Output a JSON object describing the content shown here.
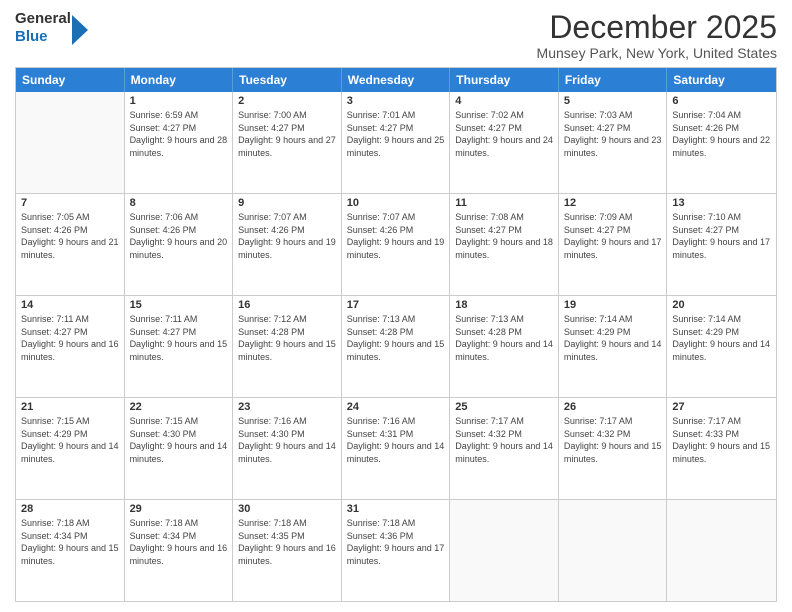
{
  "header": {
    "logo_general": "General",
    "logo_blue": "Blue",
    "title": "December 2025",
    "subtitle": "Munsey Park, New York, United States"
  },
  "days_of_week": [
    "Sunday",
    "Monday",
    "Tuesday",
    "Wednesday",
    "Thursday",
    "Friday",
    "Saturday"
  ],
  "weeks": [
    [
      {
        "day": "",
        "sunrise": "",
        "sunset": "",
        "daylight": ""
      },
      {
        "day": "1",
        "sunrise": "Sunrise: 6:59 AM",
        "sunset": "Sunset: 4:27 PM",
        "daylight": "Daylight: 9 hours and 28 minutes."
      },
      {
        "day": "2",
        "sunrise": "Sunrise: 7:00 AM",
        "sunset": "Sunset: 4:27 PM",
        "daylight": "Daylight: 9 hours and 27 minutes."
      },
      {
        "day": "3",
        "sunrise": "Sunrise: 7:01 AM",
        "sunset": "Sunset: 4:27 PM",
        "daylight": "Daylight: 9 hours and 25 minutes."
      },
      {
        "day": "4",
        "sunrise": "Sunrise: 7:02 AM",
        "sunset": "Sunset: 4:27 PM",
        "daylight": "Daylight: 9 hours and 24 minutes."
      },
      {
        "day": "5",
        "sunrise": "Sunrise: 7:03 AM",
        "sunset": "Sunset: 4:27 PM",
        "daylight": "Daylight: 9 hours and 23 minutes."
      },
      {
        "day": "6",
        "sunrise": "Sunrise: 7:04 AM",
        "sunset": "Sunset: 4:26 PM",
        "daylight": "Daylight: 9 hours and 22 minutes."
      }
    ],
    [
      {
        "day": "7",
        "sunrise": "Sunrise: 7:05 AM",
        "sunset": "Sunset: 4:26 PM",
        "daylight": "Daylight: 9 hours and 21 minutes."
      },
      {
        "day": "8",
        "sunrise": "Sunrise: 7:06 AM",
        "sunset": "Sunset: 4:26 PM",
        "daylight": "Daylight: 9 hours and 20 minutes."
      },
      {
        "day": "9",
        "sunrise": "Sunrise: 7:07 AM",
        "sunset": "Sunset: 4:26 PM",
        "daylight": "Daylight: 9 hours and 19 minutes."
      },
      {
        "day": "10",
        "sunrise": "Sunrise: 7:07 AM",
        "sunset": "Sunset: 4:26 PM",
        "daylight": "Daylight: 9 hours and 19 minutes."
      },
      {
        "day": "11",
        "sunrise": "Sunrise: 7:08 AM",
        "sunset": "Sunset: 4:27 PM",
        "daylight": "Daylight: 9 hours and 18 minutes."
      },
      {
        "day": "12",
        "sunrise": "Sunrise: 7:09 AM",
        "sunset": "Sunset: 4:27 PM",
        "daylight": "Daylight: 9 hours and 17 minutes."
      },
      {
        "day": "13",
        "sunrise": "Sunrise: 7:10 AM",
        "sunset": "Sunset: 4:27 PM",
        "daylight": "Daylight: 9 hours and 17 minutes."
      }
    ],
    [
      {
        "day": "14",
        "sunrise": "Sunrise: 7:11 AM",
        "sunset": "Sunset: 4:27 PM",
        "daylight": "Daylight: 9 hours and 16 minutes."
      },
      {
        "day": "15",
        "sunrise": "Sunrise: 7:11 AM",
        "sunset": "Sunset: 4:27 PM",
        "daylight": "Daylight: 9 hours and 15 minutes."
      },
      {
        "day": "16",
        "sunrise": "Sunrise: 7:12 AM",
        "sunset": "Sunset: 4:28 PM",
        "daylight": "Daylight: 9 hours and 15 minutes."
      },
      {
        "day": "17",
        "sunrise": "Sunrise: 7:13 AM",
        "sunset": "Sunset: 4:28 PM",
        "daylight": "Daylight: 9 hours and 15 minutes."
      },
      {
        "day": "18",
        "sunrise": "Sunrise: 7:13 AM",
        "sunset": "Sunset: 4:28 PM",
        "daylight": "Daylight: 9 hours and 14 minutes."
      },
      {
        "day": "19",
        "sunrise": "Sunrise: 7:14 AM",
        "sunset": "Sunset: 4:29 PM",
        "daylight": "Daylight: 9 hours and 14 minutes."
      },
      {
        "day": "20",
        "sunrise": "Sunrise: 7:14 AM",
        "sunset": "Sunset: 4:29 PM",
        "daylight": "Daylight: 9 hours and 14 minutes."
      }
    ],
    [
      {
        "day": "21",
        "sunrise": "Sunrise: 7:15 AM",
        "sunset": "Sunset: 4:29 PM",
        "daylight": "Daylight: 9 hours and 14 minutes."
      },
      {
        "day": "22",
        "sunrise": "Sunrise: 7:15 AM",
        "sunset": "Sunset: 4:30 PM",
        "daylight": "Daylight: 9 hours and 14 minutes."
      },
      {
        "day": "23",
        "sunrise": "Sunrise: 7:16 AM",
        "sunset": "Sunset: 4:30 PM",
        "daylight": "Daylight: 9 hours and 14 minutes."
      },
      {
        "day": "24",
        "sunrise": "Sunrise: 7:16 AM",
        "sunset": "Sunset: 4:31 PM",
        "daylight": "Daylight: 9 hours and 14 minutes."
      },
      {
        "day": "25",
        "sunrise": "Sunrise: 7:17 AM",
        "sunset": "Sunset: 4:32 PM",
        "daylight": "Daylight: 9 hours and 14 minutes."
      },
      {
        "day": "26",
        "sunrise": "Sunrise: 7:17 AM",
        "sunset": "Sunset: 4:32 PM",
        "daylight": "Daylight: 9 hours and 15 minutes."
      },
      {
        "day": "27",
        "sunrise": "Sunrise: 7:17 AM",
        "sunset": "Sunset: 4:33 PM",
        "daylight": "Daylight: 9 hours and 15 minutes."
      }
    ],
    [
      {
        "day": "28",
        "sunrise": "Sunrise: 7:18 AM",
        "sunset": "Sunset: 4:34 PM",
        "daylight": "Daylight: 9 hours and 15 minutes."
      },
      {
        "day": "29",
        "sunrise": "Sunrise: 7:18 AM",
        "sunset": "Sunset: 4:34 PM",
        "daylight": "Daylight: 9 hours and 16 minutes."
      },
      {
        "day": "30",
        "sunrise": "Sunrise: 7:18 AM",
        "sunset": "Sunset: 4:35 PM",
        "daylight": "Daylight: 9 hours and 16 minutes."
      },
      {
        "day": "31",
        "sunrise": "Sunrise: 7:18 AM",
        "sunset": "Sunset: 4:36 PM",
        "daylight": "Daylight: 9 hours and 17 minutes."
      },
      {
        "day": "",
        "sunrise": "",
        "sunset": "",
        "daylight": ""
      },
      {
        "day": "",
        "sunrise": "",
        "sunset": "",
        "daylight": ""
      },
      {
        "day": "",
        "sunrise": "",
        "sunset": "",
        "daylight": ""
      }
    ]
  ]
}
